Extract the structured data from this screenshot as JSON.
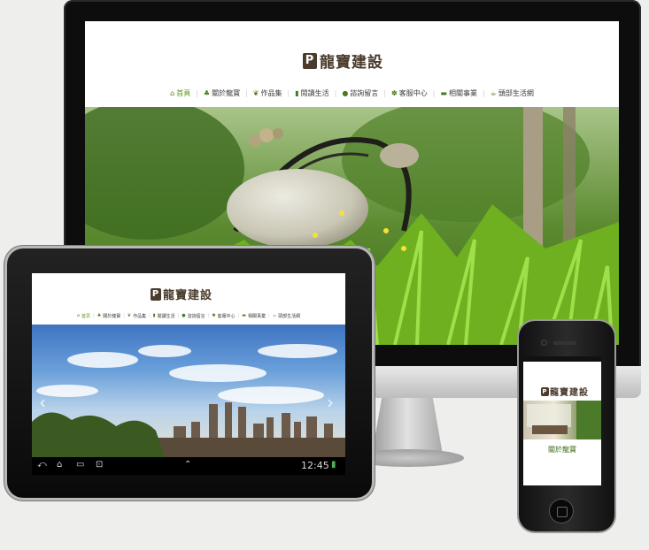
{
  "monitor_site": {
    "logo_mark": "P",
    "logo_text": "龍寶建設",
    "nav": [
      {
        "icon": "home-icon",
        "label": "首頁"
      },
      {
        "icon": "tree-icon",
        "label": "關於龍寶"
      },
      {
        "icon": "leaf-icon",
        "label": "作品集"
      },
      {
        "icon": "book-icon",
        "label": "閱讀生活"
      },
      {
        "icon": "chat-icon",
        "label": "諮詢留言"
      },
      {
        "icon": "people-icon",
        "label": "客服中心"
      },
      {
        "icon": "briefcase-icon",
        "label": "相關事業"
      },
      {
        "icon": "cup-icon",
        "label": "頭部生活網"
      }
    ]
  },
  "tablet_site": {
    "logo_mark": "P",
    "logo_text": "龍寶建設",
    "nav": [
      {
        "icon": "home-icon",
        "label": "首頁"
      },
      {
        "icon": "tree-icon",
        "label": "關於龍寶"
      },
      {
        "icon": "leaf-icon",
        "label": "作品集"
      },
      {
        "icon": "book-icon",
        "label": "閱讀生活"
      },
      {
        "icon": "chat-icon",
        "label": "諮詢留言"
      },
      {
        "icon": "people-icon",
        "label": "客服中心"
      },
      {
        "icon": "briefcase-icon",
        "label": "相關事業"
      },
      {
        "icon": "cup-icon",
        "label": "頭部生活網"
      }
    ],
    "slide_prev": "‹",
    "slide_next": "›",
    "system_time": "12:45"
  },
  "phone_site": {
    "logo_mark": "P",
    "logo_text": "龍寶建設",
    "menu_item": "關於龍寶"
  },
  "colors": {
    "brand_brown": "#4a3b2c",
    "nav_green": "#5a9a14"
  }
}
